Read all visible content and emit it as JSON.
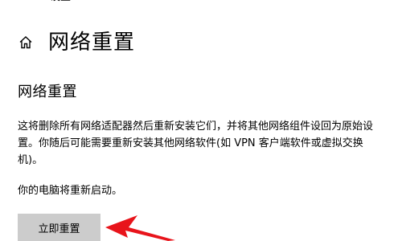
{
  "top_bar": {
    "back_glyph": "←",
    "title": "设置"
  },
  "header": {
    "title": "网络重置",
    "icon": "home-icon"
  },
  "section": {
    "title": "网络重置",
    "description": "这将删除所有网络适配器然后重新安装它们，并将其他网络组件设回为原始设置。你随后可能需要重新安装其他网络软件(如 VPN 客户端软件或虚拟交换机)。",
    "restart_note": "你的电脑将重新启动。"
  },
  "actions": {
    "reset_label": "立即重置"
  },
  "annotation": {
    "type": "arrow",
    "color": "#e8141b"
  }
}
